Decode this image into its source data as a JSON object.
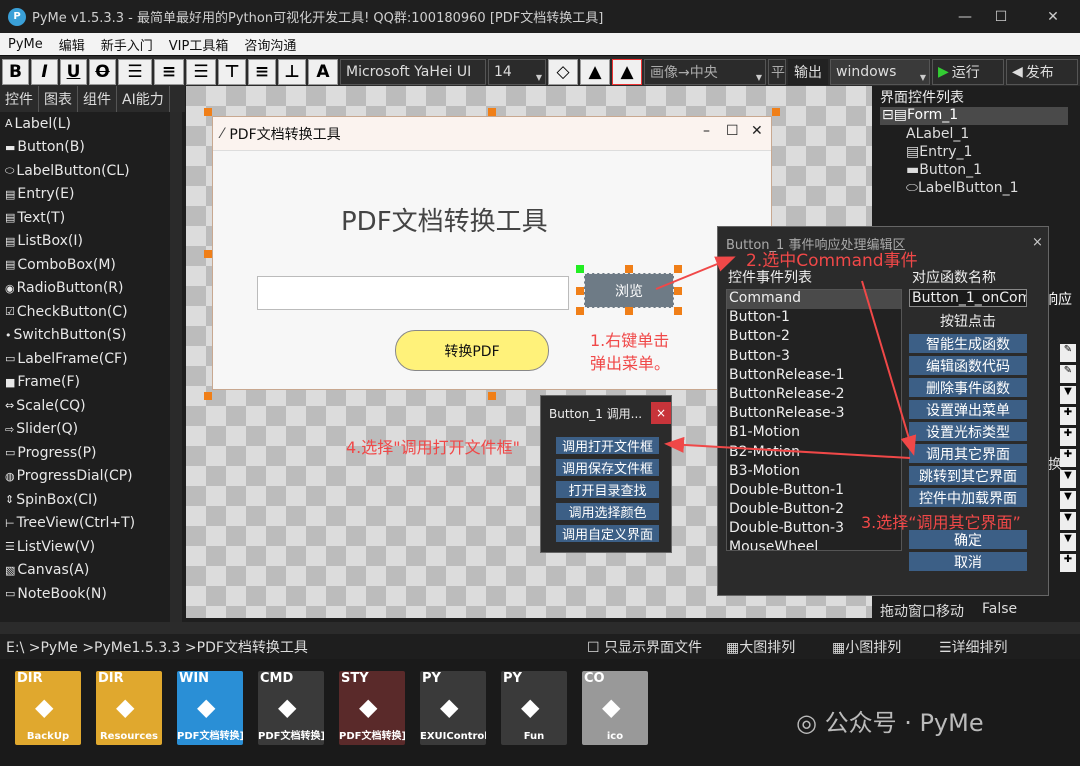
{
  "window": {
    "title": "PyMe v1.5.3.3 - 最简单最好用的Python可视化开发工具! QQ群:100180960    [PDF文档转换工具]",
    "logo": "P",
    "min": "—",
    "max": "☐",
    "close": "✕"
  },
  "menu": [
    "PyMe",
    "编辑",
    "新手入门",
    "VIP工具箱",
    "咨询沟通"
  ],
  "toolbar": {
    "bold": "B",
    "italic": "I",
    "underline": "U",
    "strike": "O",
    "font": "Microsoft YaHei UI",
    "size": "14",
    "image_pos": "画像→中央",
    "align_short": "平",
    "output": "输出",
    "platform": "windows",
    "run": "运行",
    "publish": "发布"
  },
  "left_tabs": [
    "控件",
    "图表",
    "组件",
    "AI能力"
  ],
  "widgets": [
    "Label(L)",
    "Button(B)",
    "LabelButton(CL)",
    "Entry(E)",
    "Text(T)",
    "ListBox(I)",
    "ComboBox(M)",
    "RadioButton(R)",
    "CheckButton(C)",
    "SwitchButton(S)",
    "LabelFrame(CF)",
    "Frame(F)",
    "Scale(CQ)",
    "Slider(Q)",
    "Progress(P)",
    "ProgressDial(CP)",
    "SpinBox(CI)",
    "TreeView(Ctrl+T)",
    "ListView(V)",
    "Canvas(A)",
    "NoteBook(N)"
  ],
  "form": {
    "title": "PDF文档转换工具",
    "heading": "PDF文档转换工具",
    "browse": "浏览",
    "convert": "转换PDF",
    "entry_value": ""
  },
  "right": {
    "header": "界面控件列表",
    "tree": [
      "Form_1",
      "Label_1",
      "Entry_1",
      "Button_1",
      "LabelButton_1"
    ],
    "response_label": "响应",
    "prop_name": "拖动窗口移动",
    "prop_value": "False",
    "partial": "换"
  },
  "event_dialog": {
    "title": "Button_1 事件响应处理编辑区",
    "close": "×",
    "list_header": "控件事件列表",
    "func_header": "对应函数名称",
    "func_value": "Button_1_onCom",
    "func_desc": "按钮点击",
    "events": [
      "Command",
      "Button-1",
      "Button-2",
      "Button-3",
      "ButtonRelease-1",
      "ButtonRelease-2",
      "ButtonRelease-3",
      "B1-Motion",
      "B2-Motion",
      "B3-Motion",
      "Double-Button-1",
      "Double-Button-2",
      "Double-Button-3",
      "MouseWheel"
    ],
    "buttons": [
      "智能生成函数",
      "编辑函数代码",
      "删除事件函数",
      "设置弹出菜单",
      "设置光标类型",
      "调用其它界面",
      "跳转到其它界面",
      "控件中加载界面"
    ],
    "ok": "确定",
    "cancel": "取消"
  },
  "popup": {
    "title": "Button_1 调用...",
    "close": "×",
    "items": [
      "调用打开文件框",
      "调用保存文件框",
      "打开目录查找",
      "调用选择颜色",
      "调用自定义界面"
    ]
  },
  "annotations": {
    "a1": "1.右键单击",
    "a1b": "弹出菜单。",
    "a2": "2.选中Command事件",
    "a3": "3.选择“调用其它界面”",
    "a4": "4.选择\"调用打开文件框\""
  },
  "pathbar": {
    "path": "E:\\ >PyMe >PyMe1.5.3.3 >PDF文档转换工具",
    "only_ui": "只显示界面文件",
    "large": "大图排列",
    "small": "小图排列",
    "detail": "详细排列"
  },
  "files": [
    {
      "tag": "DIR",
      "label": "BackUp",
      "color": "#e0a82e"
    },
    {
      "tag": "DIR",
      "label": "Resources",
      "color": "#e0a82e"
    },
    {
      "tag": "WIN",
      "label": "PDF文档转换]",
      "color": "#2a8fd6"
    },
    {
      "tag": "CMD",
      "label": "PDF文档转换]",
      "color": "#3a3a3a"
    },
    {
      "tag": "STY",
      "label": "PDF文档转换]",
      "color": "#5a2a2a"
    },
    {
      "tag": "PY",
      "label": "EXUIControl",
      "color": "#3a3a3a"
    },
    {
      "tag": "PY",
      "label": "Fun",
      "color": "#3a3a3a"
    },
    {
      "tag": "CO",
      "label": "ico",
      "color": "#999999"
    }
  ],
  "watermark": "公众号 · PyMe"
}
